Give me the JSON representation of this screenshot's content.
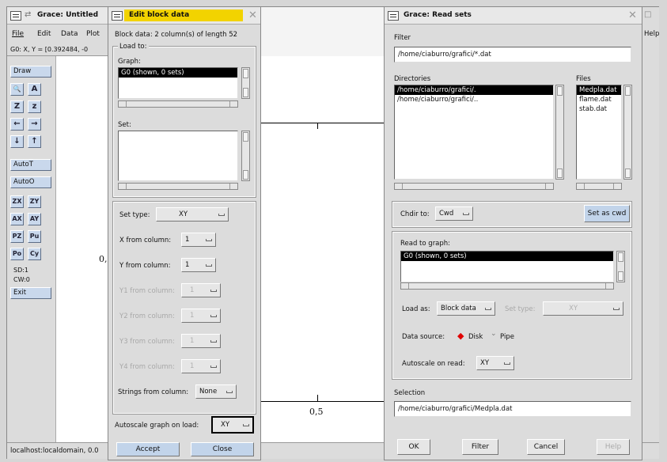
{
  "grace_main": {
    "title": "Grace: Untitled",
    "menu": [
      "File",
      "Edit",
      "Data",
      "Plot"
    ],
    "coords": "G0: X, Y = [0.392484, -0",
    "tools": {
      "draw": "Draw",
      "zoom_glyph": "🔍",
      "ax_glyph": "A",
      "z1": "Z",
      "z2": "z",
      "left": "←",
      "right": "→",
      "down": "↓",
      "up": "↑",
      "autot": "AutoT",
      "autoo": "AutoO",
      "zx": "ZX",
      "zy": "ZY",
      "ax": "AX",
      "ay": "AY",
      "pz": "PZ",
      "pu": "Pu",
      "po": "Po",
      "cy": "Cy",
      "sd": "SD:1",
      "cw": "CW:0",
      "exit": "Exit"
    },
    "canvas": {
      "ytick": "0,",
      "xtick": "0,5"
    },
    "status": "localhost:localdomain, 0.0",
    "help": "Help"
  },
  "edit_block": {
    "title": "Edit block data",
    "info": "Block data: 2 column(s) of length 52",
    "load_to": "Load to:",
    "graph_label": "Graph:",
    "graph_item": "G0 (shown, 0 sets)",
    "set_label": "Set:",
    "set_type_label": "Set type:",
    "set_type_value": "XY",
    "x_from": "X from column:",
    "x_value": "1",
    "y_from": "Y from column:",
    "y_value": "1",
    "y1_from": "Y1 from column:",
    "y1_value": "1",
    "y2_from": "Y2 from column:",
    "y2_value": "1",
    "y3_from": "Y3 from column:",
    "y3_value": "1",
    "y4_from": "Y4 from column:",
    "y4_value": "1",
    "strings_from": "Strings from column:",
    "strings_value": "None",
    "autoscale_label": "Autoscale graph on load:",
    "autoscale_value": "XY",
    "accept": "Accept",
    "close": "Close"
  },
  "read_sets": {
    "title": "Grace: Read sets",
    "filter_label": "Filter",
    "filter_value": "/home/ciaburro/grafici/*.dat",
    "directories_label": "Directories",
    "directories": [
      "/home/ciaburro/grafici/.",
      "/home/ciaburro/grafici/.."
    ],
    "files_label": "Files",
    "files": [
      "Medpla.dat",
      "flame.dat",
      "stab.dat"
    ],
    "chdir_label": "Chdir to:",
    "chdir_value": "Cwd",
    "set_as_cwd": "Set as cwd",
    "read_to_graph": "Read to graph:",
    "graph_item": "G0 (shown, 0 sets)",
    "load_as_label": "Load as:",
    "load_as_value": "Block data",
    "set_type_label": "Set type:",
    "set_type_value": "XY",
    "data_source_label": "Data source:",
    "disk": "Disk",
    "pipe": "Pipe",
    "autoscale_label": "Autoscale on read:",
    "autoscale_value": "XY",
    "selection_label": "Selection",
    "selection_value": "/home/ciaburro/grafici/Medpla.dat",
    "ok": "OK",
    "filter_btn": "Filter",
    "cancel": "Cancel",
    "help": "Help"
  },
  "colors": {
    "highlight_title": "#f2d300",
    "tool_blue": "#c9d8ec",
    "selection": "#000000"
  }
}
